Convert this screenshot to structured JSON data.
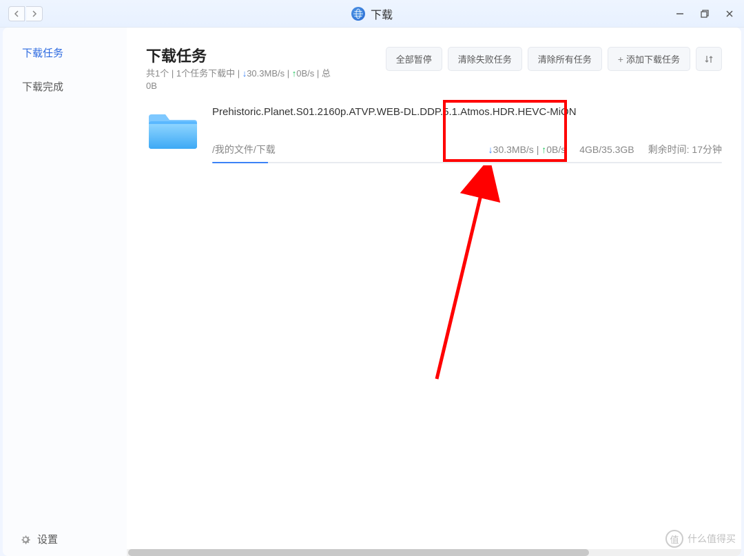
{
  "titlebar": {
    "title": "下载",
    "nav_back": "‹",
    "nav_fwd": "›"
  },
  "sidebar": {
    "tasks": "下载任务",
    "completed": "下载完成",
    "settings": "设置"
  },
  "header": {
    "title": "下载任务",
    "summary_count": "共1个",
    "summary_running": "1个任务下载中",
    "summary_down": "30.3MB/s",
    "summary_up": "0B/s",
    "summary_total_prefix": "总",
    "summary_total_val": "0B"
  },
  "toolbar": {
    "pause_all": "全部暂停",
    "clear_failed": "清除失败任务",
    "clear_all": "清除所有任务",
    "add_task": "添加下载任务"
  },
  "task": {
    "name": "Prehistoric.Planet.S01.2160p.ATVP.WEB-DL.DDP.5.1.Atmos.HDR.HEVC-MiON",
    "path": "/我的文件/下载",
    "down_speed": "30.3MB/s",
    "up_speed": "0B/s",
    "size": "4GB/35.3GB",
    "remain_label": "剩余时间:",
    "remain_value": "17分钟"
  },
  "watermark": {
    "char": "值",
    "text": "什么值得买"
  }
}
